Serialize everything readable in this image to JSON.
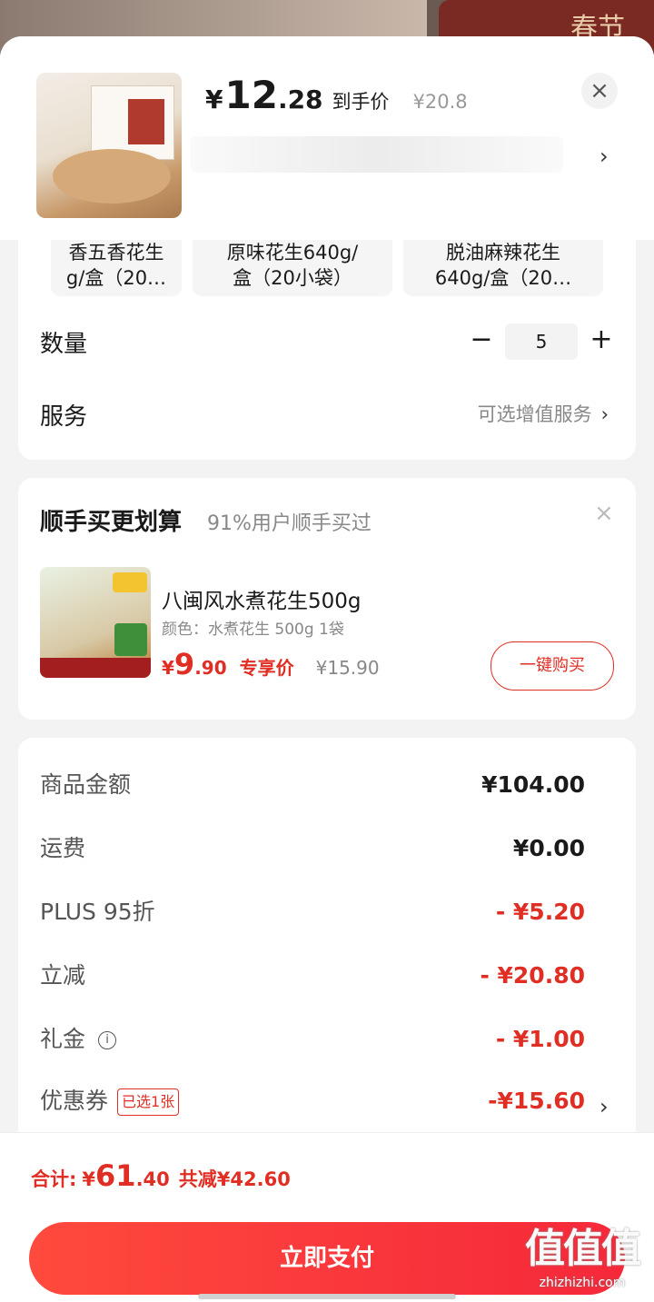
{
  "background": {
    "banner_text": "春节"
  },
  "product": {
    "price_yen": "¥",
    "price_int": "12",
    "price_dec": ".28",
    "price_tag": "到手价",
    "original_price": "¥20.8"
  },
  "options": [
    {
      "line1": "香五香花生",
      "line2": "g/盒（20…"
    },
    {
      "line1": "原味花生640g/",
      "line2": "盒（20小袋）"
    },
    {
      "line1": "脱油麻辣花生",
      "line2": "640g/盒（20…"
    }
  ],
  "quantity": {
    "label": "数量",
    "value": "5",
    "minus": "−",
    "plus": "+"
  },
  "service": {
    "label": "服务",
    "hint": "可选增值服务",
    "chev": "›"
  },
  "recommend": {
    "title": "顺手买更划算",
    "subtitle": "91%用户顺手买过",
    "close": "×",
    "item_name": "八闽风水煮花生500g",
    "item_spec": "颜色：水煮花生 500g 1袋",
    "price_yen": "¥",
    "price_int": "9",
    "price_dec": ".90",
    "price_tag": "专享价",
    "original_price": "¥15.90",
    "buy_label": "一键购买"
  },
  "summary": [
    {
      "label": "商品金额",
      "value": "¥104.00",
      "style": "dark"
    },
    {
      "label": "运费",
      "value": "¥0.00",
      "style": "dark"
    },
    {
      "label": "PLUS 95折",
      "value": "- ¥5.20",
      "style": "red"
    },
    {
      "label": "立减",
      "value": "- ¥20.80",
      "style": "red"
    },
    {
      "label": "礼金",
      "value": "- ¥1.00",
      "style": "red"
    },
    {
      "label": "优惠券",
      "value": "-¥15.60",
      "style": "red",
      "tag": "已选1张"
    }
  ],
  "footer": {
    "total_label": "合计:",
    "total_yen": "¥",
    "total_int": "61",
    "total_dec": ".40",
    "saved": "共减¥42.60",
    "pay_label": "立即支付"
  },
  "watermark": {
    "big": "值值值",
    "small": "zhizhizhi.com"
  },
  "colors": {
    "accent": "#e02e24",
    "pay_button": "#f5283a"
  }
}
